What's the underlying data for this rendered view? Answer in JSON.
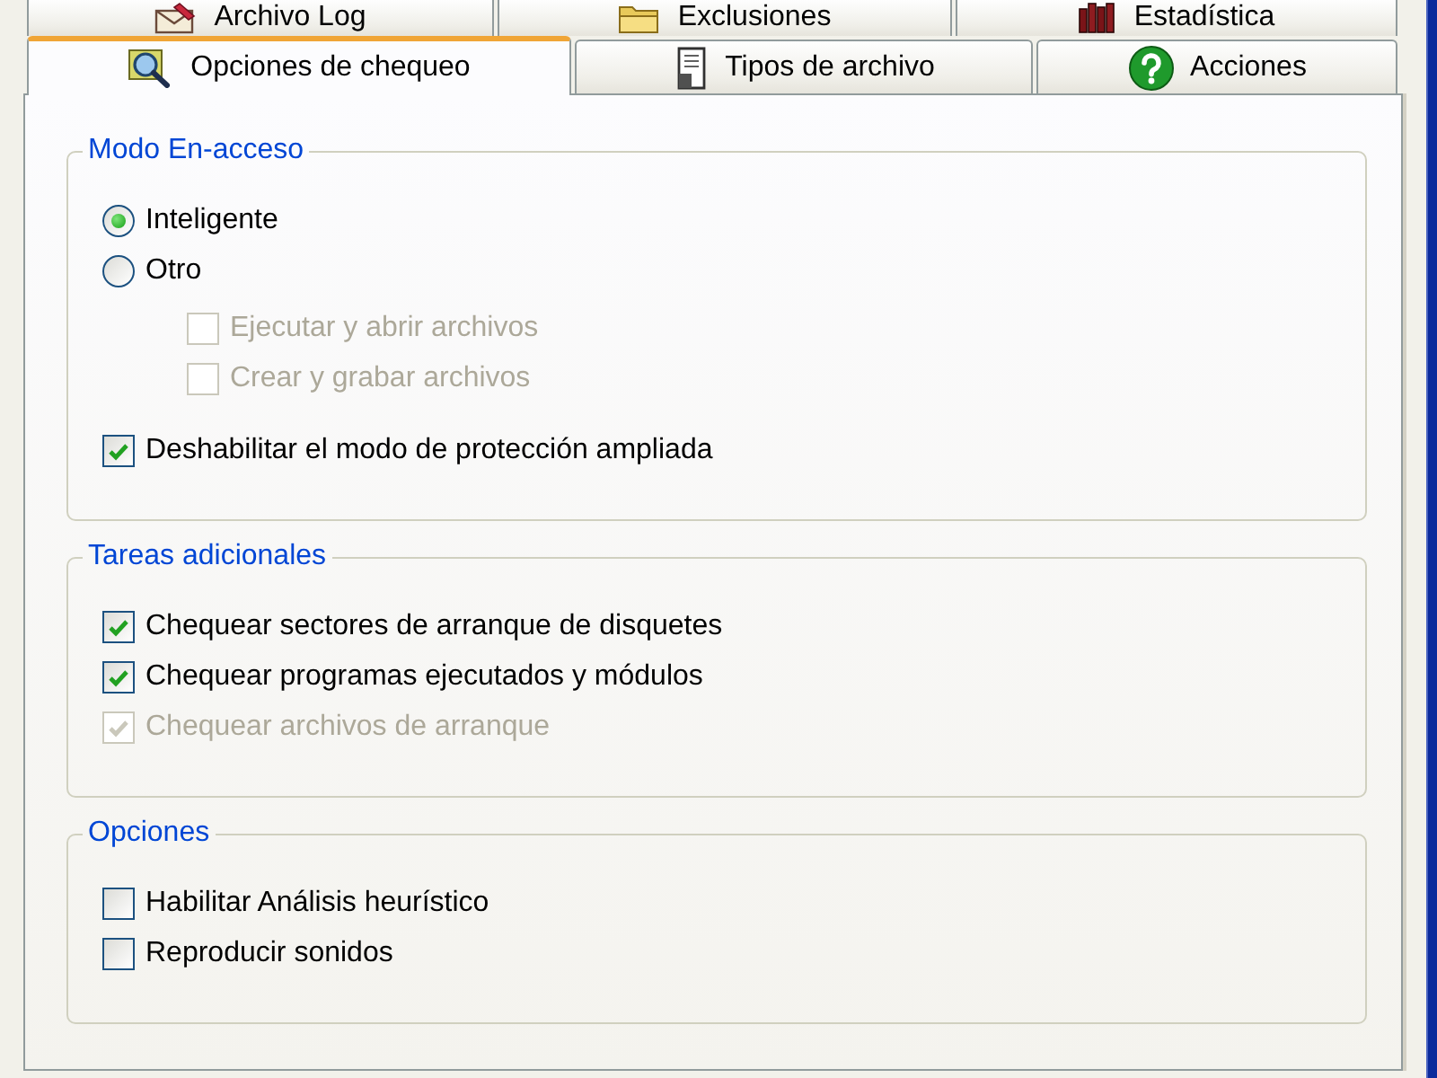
{
  "tab_rows": [
    {
      "tabs": [
        {
          "label": "Archivo Log",
          "selected": false
        },
        {
          "label": "Exclusiones",
          "selected": false
        },
        {
          "label": "Estadística",
          "selected": false
        }
      ]
    },
    {
      "tabs": [
        {
          "label": "Opciones de chequeo",
          "selected": true
        },
        {
          "label": "Tipos de archivo",
          "selected": false
        },
        {
          "label": "Acciones",
          "selected": false
        }
      ]
    }
  ],
  "groups": [
    {
      "title": "Modo En-acceso",
      "items": [
        {
          "kind": "radio",
          "label": "Inteligente",
          "selected": true,
          "disabled": false
        },
        {
          "kind": "radio",
          "label": "Otro",
          "selected": false,
          "disabled": false,
          "children": [
            {
              "kind": "checkbox",
              "label": "Ejecutar y abrir archivos",
              "checked": false,
              "disabled": true
            },
            {
              "kind": "checkbox",
              "label": "Crear y grabar archivos",
              "checked": false,
              "disabled": true
            }
          ]
        },
        {
          "kind": "checkbox",
          "label": "Deshabilitar el modo de protección ampliada",
          "checked": true,
          "disabled": false
        }
      ]
    },
    {
      "title": "Tareas adicionales",
      "items": [
        {
          "kind": "checkbox",
          "label": "Chequear sectores de arranque de disquetes",
          "checked": true,
          "disabled": false
        },
        {
          "kind": "checkbox",
          "label": "Chequear programas ejecutados y módulos",
          "checked": true,
          "disabled": false
        },
        {
          "kind": "checkbox",
          "label": "Chequear archivos de arranque",
          "checked": true,
          "disabled": true
        }
      ]
    },
    {
      "title": "Opciones",
      "items": [
        {
          "kind": "checkbox",
          "label": "Habilitar Análisis heurístico",
          "checked": false,
          "disabled": false
        },
        {
          "kind": "checkbox",
          "label": "Reproducir sonidos",
          "checked": false,
          "disabled": false
        }
      ]
    }
  ]
}
